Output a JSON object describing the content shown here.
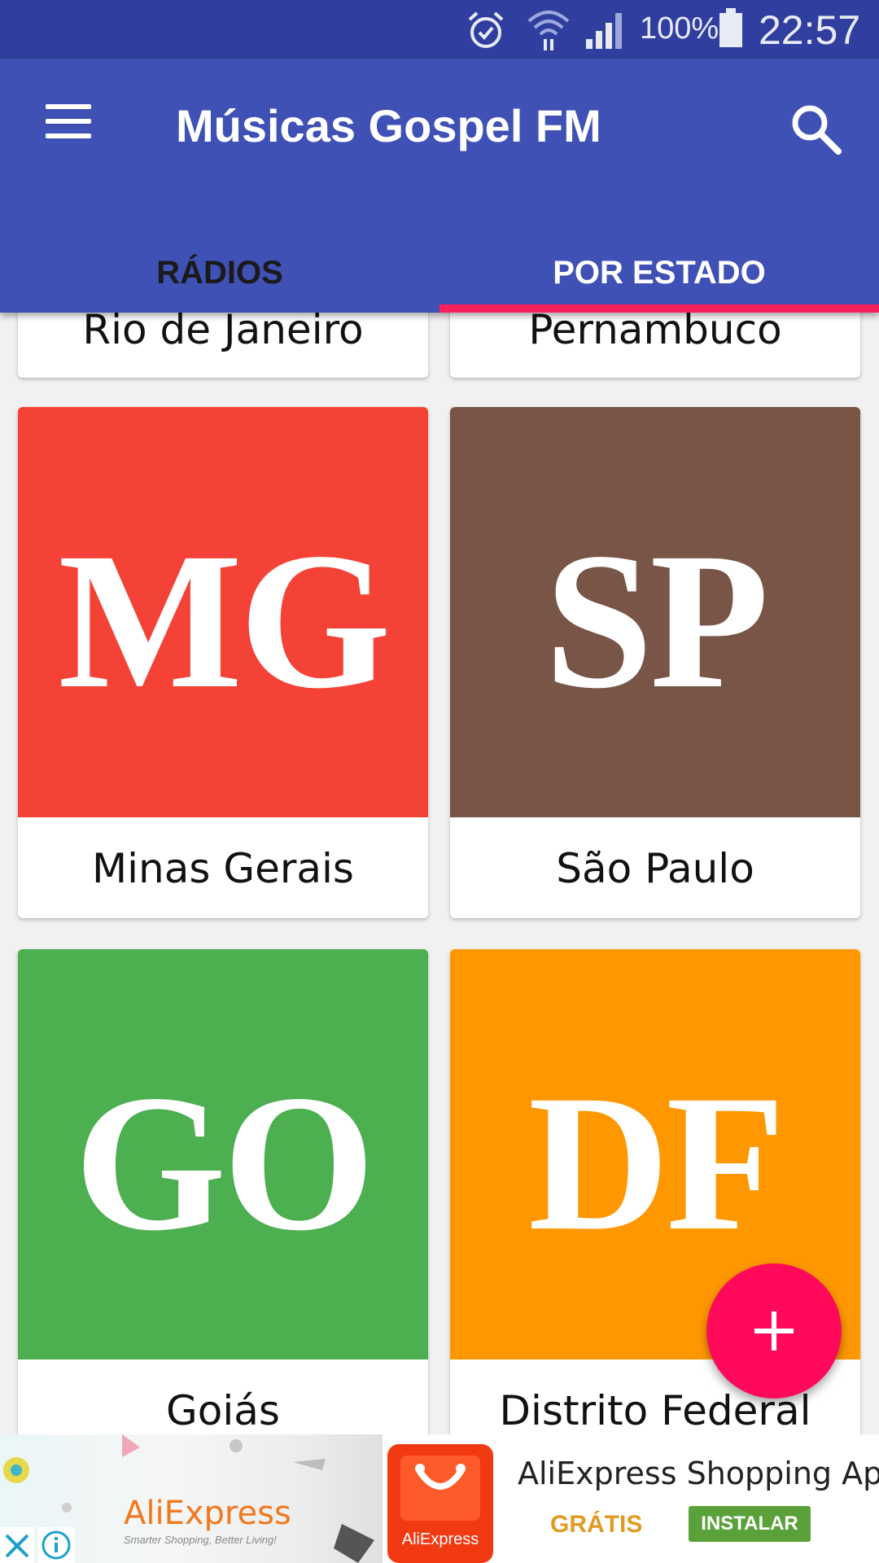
{
  "status_bar": {
    "battery_percent": "100%",
    "time": "22:57",
    "icons": [
      "alarm-icon",
      "wifi-icon",
      "signal-icon",
      "battery-icon"
    ]
  },
  "app_bar": {
    "title": "Músicas Gospel FM",
    "menu_icon": "hamburger-menu-icon",
    "search_icon": "search-icon"
  },
  "tabs": [
    {
      "label": "RÁDIOS",
      "selected": false
    },
    {
      "label": "POR ESTADO",
      "selected": true
    }
  ],
  "states": [
    {
      "abbr": "",
      "name": "Rio de Janeiro"
    },
    {
      "abbr": "",
      "name": "Pernambuco"
    },
    {
      "abbr": "MG",
      "name": "Minas Gerais",
      "color": "#f44336"
    },
    {
      "abbr": "SP",
      "name": "São Paulo",
      "color": "#795548"
    },
    {
      "abbr": "GO",
      "name": "Goiás",
      "color": "#4caf50"
    },
    {
      "abbr": "DF",
      "name": "Distrito Federal",
      "color": "#ff9800"
    }
  ],
  "fab": {
    "icon": "plus-icon"
  },
  "ad": {
    "brand": "AliExpress",
    "tagline": "Smarter Shopping, Better Living!",
    "icon_label": "AliExpress",
    "title": "AliExpress Shopping App",
    "price": "GRÁTIS",
    "install_label": "INSTALAR"
  },
  "colors": {
    "status_bar": "#303f9f",
    "app_bar": "#3f51b5",
    "tab_indicator": "#ff1f5a",
    "fab": "#ff0a5a"
  }
}
